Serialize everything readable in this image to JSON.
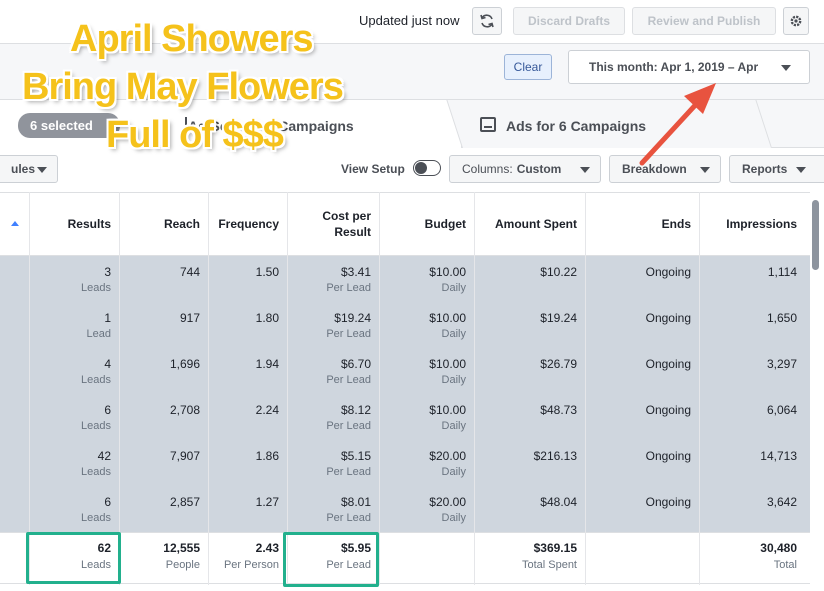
{
  "header": {
    "updated_text": "Updated just now",
    "discard_label": "Discard Drafts",
    "review_label": "Review and Publish"
  },
  "filters": {
    "clear_label": "Clear",
    "date_label": "This month: Apr 1, 2019 – Apr"
  },
  "tabs": {
    "selected_label": "6 selected",
    "adsets_label": "Ad Sets for 6 Campaigns",
    "ads_label": "Ads for 6 Campaigns"
  },
  "toolbar": {
    "rules_label": "ules",
    "view_setup_label": "View Setup",
    "columns_prefix": "Columns:",
    "columns_value": "Custom",
    "breakdown_label": "Breakdown",
    "reports_label": "Reports"
  },
  "columns": {
    "results": "Results",
    "reach": "Reach",
    "frequency": "Frequency",
    "cost": "Cost per Result",
    "budget": "Budget",
    "amount": "Amount Spent",
    "ends": "Ends",
    "impressions": "Impressions"
  },
  "rows": [
    {
      "results": "3",
      "results_unit": "Leads",
      "reach": "744",
      "frequency": "1.50",
      "cost": "$3.41",
      "cost_unit": "Per Lead",
      "budget": "$10.00",
      "budget_unit": "Daily",
      "amount": "$10.22",
      "ends": "Ongoing",
      "impressions": "1,114"
    },
    {
      "results": "1",
      "results_unit": "Lead",
      "reach": "917",
      "frequency": "1.80",
      "cost": "$19.24",
      "cost_unit": "Per Lead",
      "budget": "$10.00",
      "budget_unit": "Daily",
      "amount": "$19.24",
      "ends": "Ongoing",
      "impressions": "1,650"
    },
    {
      "results": "4",
      "results_unit": "Leads",
      "reach": "1,696",
      "frequency": "1.94",
      "cost": "$6.70",
      "cost_unit": "Per Lead",
      "budget": "$10.00",
      "budget_unit": "Daily",
      "amount": "$26.79",
      "ends": "Ongoing",
      "impressions": "3,297"
    },
    {
      "results": "6",
      "results_unit": "Leads",
      "reach": "2,708",
      "frequency": "2.24",
      "cost": "$8.12",
      "cost_unit": "Per Lead",
      "budget": "$10.00",
      "budget_unit": "Daily",
      "amount": "$48.73",
      "ends": "Ongoing",
      "impressions": "6,064"
    },
    {
      "results": "42",
      "results_unit": "Leads",
      "reach": "7,907",
      "frequency": "1.86",
      "cost": "$5.15",
      "cost_unit": "Per Lead",
      "budget": "$20.00",
      "budget_unit": "Daily",
      "amount": "$216.13",
      "ends": "Ongoing",
      "impressions": "14,713"
    },
    {
      "results": "6",
      "results_unit": "Leads",
      "reach": "2,857",
      "frequency": "1.27",
      "cost": "$8.01",
      "cost_unit": "Per Lead",
      "budget": "$20.00",
      "budget_unit": "Daily",
      "amount": "$48.04",
      "ends": "Ongoing",
      "impressions": "3,642"
    }
  ],
  "totals": {
    "results": "62",
    "results_unit": "Leads",
    "reach": "12,555",
    "reach_unit": "People",
    "frequency": "2.43",
    "frequency_unit": "Per Person",
    "cost": "$5.95",
    "cost_unit": "Per Lead",
    "amount": "$369.15",
    "amount_unit": "Total Spent",
    "impressions": "30,480",
    "impressions_unit": "Total"
  },
  "overlay": {
    "line1": "April Showers",
    "line2": "Bring May Flowers",
    "line3": "Full of $$$"
  },
  "colors": {
    "headline": "#f5c21b",
    "highlight_box": "#22b08d",
    "arrow": "#e8533f",
    "table_body": "#cfd6de"
  }
}
